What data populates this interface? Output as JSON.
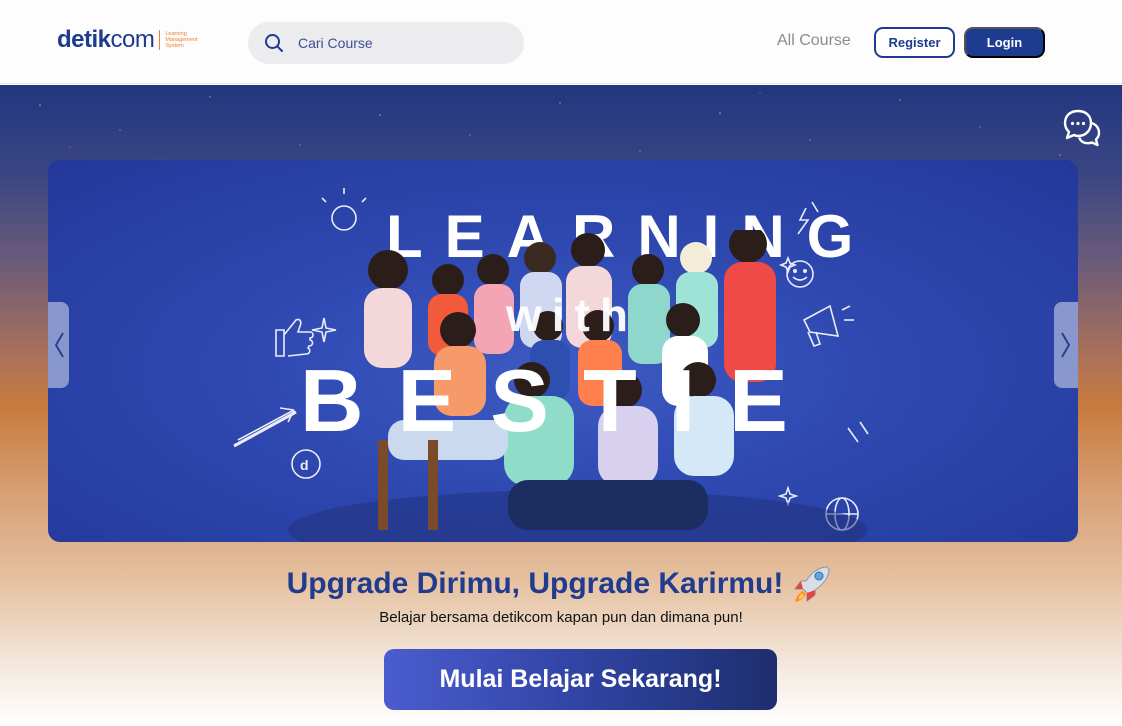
{
  "header": {
    "logo": {
      "brand": "detikcom",
      "brand_part1": "detik",
      "brand_part2": "com",
      "tagline": "Learning Management System"
    },
    "search": {
      "placeholder": "Cari Course",
      "icon": "search-icon"
    },
    "nav": {
      "all_course": "All Course",
      "register": "Register",
      "login": "Login"
    }
  },
  "hero": {
    "banner": {
      "title_line1": "LEARNING",
      "title_line2": "with",
      "title_line3": "BESTIE",
      "image": "group-of-young-people-pointing-photo"
    },
    "prev_icon": "chevron-left-icon",
    "next_icon": "chevron-right-icon",
    "chat_icon": "chat-bubbles-icon",
    "headline": "Upgrade Dirimu, Upgrade Karirmu!",
    "headline_icon": "rocket-icon",
    "subheadline": "Belajar bersama detikcom kapan pun dan dimana pun!",
    "cta_label": "Mulai Belajar Sekarang!"
  },
  "colors": {
    "brand_blue": "#1d3b8f",
    "brand_orange": "#f27e2b",
    "banner_blue": "#2e48b0"
  }
}
